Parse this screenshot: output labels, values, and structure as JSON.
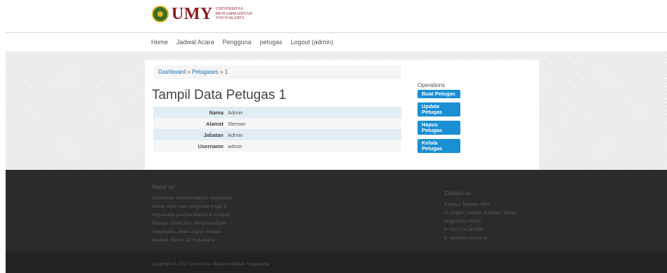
{
  "logo": {
    "brand": "UMY",
    "lines": [
      "UNIVERSITAS",
      "MUHAMMADIYAH",
      "YOGYAKARTA"
    ]
  },
  "nav": [
    "Home",
    "Jadwal Acara",
    "Pengguna",
    "petugas",
    "Logout (admin)"
  ],
  "breadcrumb": {
    "dashboard": "Dashboard",
    "petugases": "Petugases",
    "separator": "»",
    "current": "1"
  },
  "page_title": "Tampil Data Petugas 1",
  "details": [
    {
      "label": "Nama",
      "value": "Admin"
    },
    {
      "label": "Alamat",
      "value": "Sleman"
    },
    {
      "label": "Jabatan",
      "value": "Admin"
    },
    {
      "label": "Username",
      "value": "admin"
    }
  ],
  "operations": {
    "title": "Operations",
    "buttons": [
      {
        "lines": [
          "Buat Petugas"
        ]
      },
      {
        "lines": [
          "Update",
          "Petugas"
        ]
      },
      {
        "lines": [
          "Hapus",
          "Petugas"
        ]
      },
      {
        "lines": [
          "Kelola",
          "Petugas"
        ]
      }
    ]
  },
  "footer": {
    "about_title": "About us",
    "about_lines": [
      "Universitas Muhammadiyah Yogyakarta",
      "adalah salah satu perguruan tinggi di",
      "Yogyakarta yang beralamat di Kampus",
      "Terpadu Universitas Muhammadiyah",
      "Yogyakarta, Jalan Lingkar Selatan,",
      "Kasihan, Bantul, DI Yogyakarta"
    ],
    "contact_title": "Contact us",
    "contact_lines": [
      "Kampus Terpadu UMY",
      "Jl. Lingkar Selatan, Kasihan, Bantul",
      "Yogyakarta 55183",
      "P: +62 274 387656",
      "E: webmail.umy.ac.id"
    ],
    "copyright": "Copyright © 2017 Universitas Muhammadiyah Yogyakarta"
  },
  "colors": {
    "accent": "#1a8fd4",
    "brand": "#8a1c1c",
    "footer_bg": "#2b2b2b"
  }
}
